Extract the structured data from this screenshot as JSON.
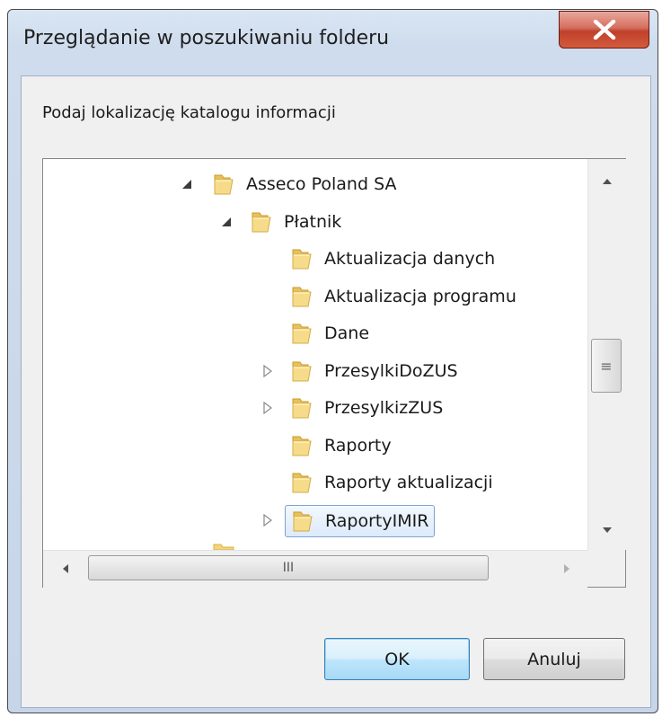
{
  "window": {
    "title": "Przeglądanie w poszukiwaniu folderu",
    "close_icon": "close-x-icon"
  },
  "dialog": {
    "prompt": "Podaj lokalizację katalogu informacji"
  },
  "tree": {
    "items": [
      {
        "label": "Asseco Poland SA",
        "level": 0,
        "expander": "expanded"
      },
      {
        "label": "Płatnik",
        "level": 1,
        "expander": "expanded"
      },
      {
        "label": "Aktualizacja danych",
        "level": 2,
        "expander": "none"
      },
      {
        "label": "Aktualizacja programu",
        "level": 2,
        "expander": "none"
      },
      {
        "label": "Dane",
        "level": 2,
        "expander": "none"
      },
      {
        "label": "PrzesylkiDoZUS",
        "level": 2,
        "expander": "collapsed"
      },
      {
        "label": "PrzesylkizZUS",
        "level": 2,
        "expander": "collapsed"
      },
      {
        "label": "Raporty",
        "level": 2,
        "expander": "none"
      },
      {
        "label": "Raporty aktualizacji",
        "level": 2,
        "expander": "none"
      },
      {
        "label": "RaportyIMIR",
        "level": 2,
        "expander": "collapsed",
        "selected": true
      }
    ]
  },
  "scrollbar": {
    "hthumb_grip": "III",
    "vthumb_grip": "≡"
  },
  "buttons": {
    "ok": "OK",
    "cancel": "Anuluj"
  },
  "colors": {
    "close_button": "#c0402b",
    "selection_border": "#7da2ce",
    "default_button_border": "#3c7fb1",
    "folder_yellow": "#f3d57a"
  }
}
